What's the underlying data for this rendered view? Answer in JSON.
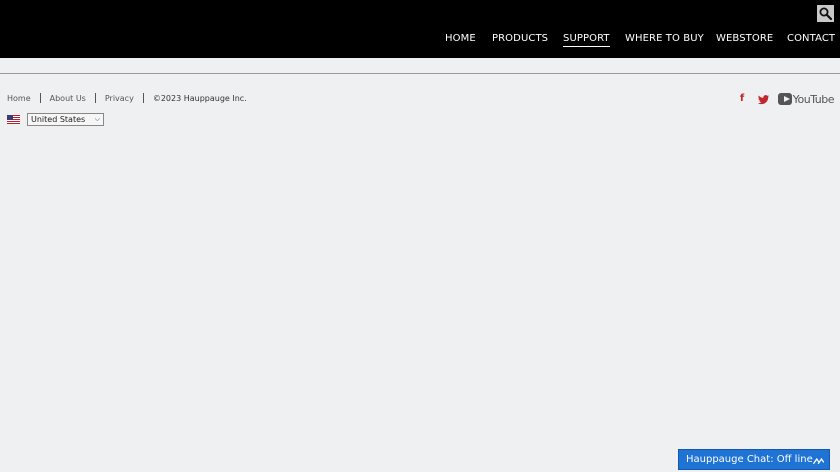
{
  "header": {
    "search_icon": "search-icon",
    "nav": [
      {
        "label": "HOME",
        "active": false
      },
      {
        "label": "PRODUCTS",
        "active": false
      },
      {
        "label": "SUPPORT",
        "active": true
      },
      {
        "label": "WHERE TO BUY",
        "active": false
      },
      {
        "label": "WEBSTORE",
        "active": false
      },
      {
        "label": "CONTACT",
        "active": false
      }
    ]
  },
  "footer": {
    "links": [
      "Home",
      "About Us",
      "Privacy"
    ],
    "copyright": "©2023 Hauppauge Inc.",
    "country_flag": "us-flag-icon",
    "country_selected": "United States",
    "social": {
      "facebook": "f",
      "twitter_icon": "twitter-icon",
      "youtube_label": "YouTube"
    }
  },
  "chat": {
    "label": "Hauppauge Chat: Off line",
    "maximize_icon": "maximize-icon"
  },
  "colors": {
    "header_bg": "#000000",
    "page_bg": "#eff0f2",
    "social_red": "#c0282d",
    "chat_blue": "#1e73d4"
  }
}
